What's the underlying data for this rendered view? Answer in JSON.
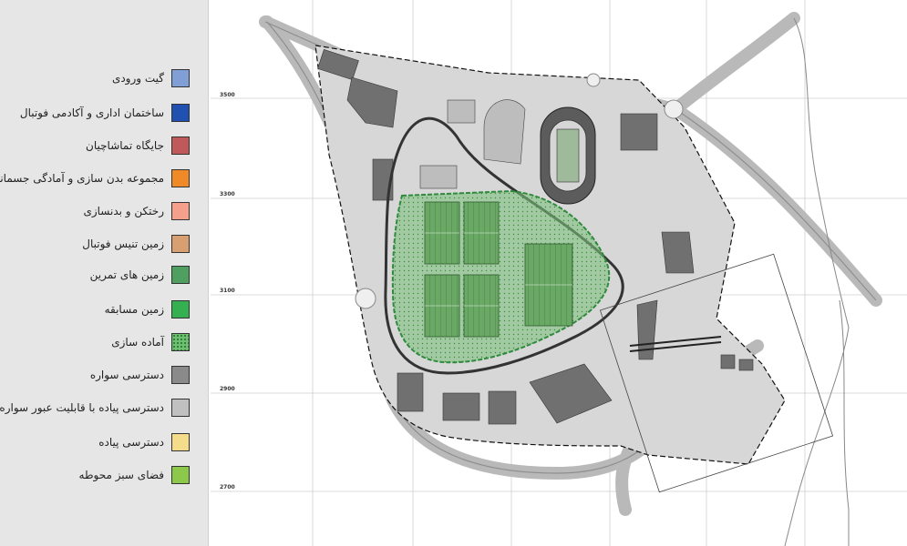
{
  "legend": {
    "items": [
      {
        "label": "گیت ورودی",
        "color": "#7f9fd6",
        "pattern": "solid"
      },
      {
        "label": "ساختمان اداری و آکادمی فوتبال",
        "color": "#2050b0",
        "pattern": "solid"
      },
      {
        "label": "جایگاه تماشاچیان",
        "color": "#c05a5a",
        "pattern": "solid"
      },
      {
        "label": "مجموعه بدن سازی و آمادگی جسمانی",
        "color": "#f08a28",
        "pattern": "solid"
      },
      {
        "label": "رختکن و بدنسازی",
        "color": "#f4a08a",
        "pattern": "solid"
      },
      {
        "label": "زمین تنیس فوتبال",
        "color": "#d8a070",
        "pattern": "solid"
      },
      {
        "label": "زمین های تمرین",
        "color": "#4fa060",
        "pattern": "solid"
      },
      {
        "label": "زمین مسابقه",
        "color": "#34b050",
        "pattern": "solid"
      },
      {
        "label": "آماده سازی",
        "color": "#6cc070",
        "pattern": "dotted"
      },
      {
        "label": "دسترسی سواره",
        "color": "#8a8a8a",
        "pattern": "solid"
      },
      {
        "label": "دسترسی پیاده با قابلیت عبور سواره",
        "color": "#c0c0c0",
        "pattern": "solid"
      },
      {
        "label": "دسترسی پیاده",
        "color": "#f5dc8a",
        "pattern": "solid"
      },
      {
        "label": "فضای سبز محوطه",
        "color": "#8cc84a",
        "pattern": "solid"
      }
    ]
  },
  "grid": {
    "labels": [
      "3500",
      "3300",
      "3100",
      "2900",
      "2700"
    ]
  }
}
